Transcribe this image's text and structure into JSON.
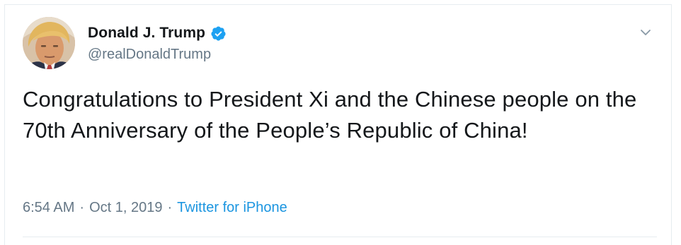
{
  "tweet": {
    "author": {
      "name": "Donald J. Trump",
      "handle": "@realDonaldTrump",
      "verified": true,
      "avatar_icon": "profile-photo"
    },
    "text": "Congratulations to President Xi and the Chinese people on the 70th Anniversary of the People’s Republic of China!",
    "time": "6:54 AM",
    "date": "Oct 1, 2019",
    "separator": "·",
    "source": "Twitter for iPhone",
    "menu_icon": "chevron-down-icon"
  },
  "colors": {
    "text_primary": "#14171a",
    "text_secondary": "#657786",
    "link": "#1b95e0",
    "verified_badge": "#1da1f2",
    "border": "#e6ecf0"
  }
}
